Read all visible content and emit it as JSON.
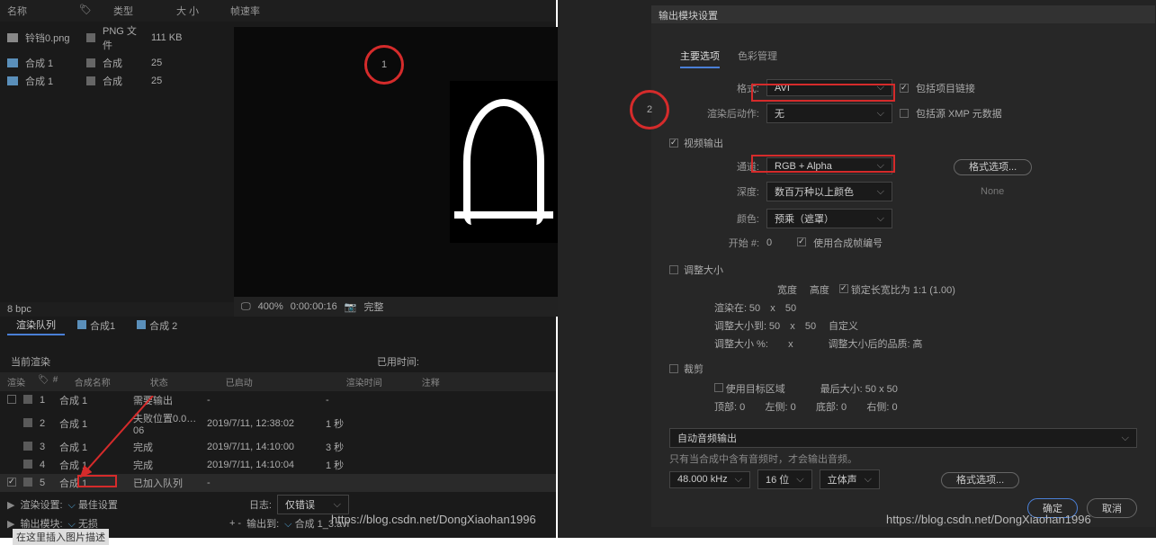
{
  "project": {
    "headers": {
      "name": "名称",
      "label": "类型",
      "size": "大 小",
      "fps": "帧速率"
    },
    "rows": [
      {
        "name": "铃铛0.png",
        "type": "PNG 文件",
        "size": "111 KB",
        "fps": ""
      },
      {
        "name": "合成 1",
        "type": "合成",
        "size": "25",
        "fps": ""
      },
      {
        "name": "合成 1",
        "type": "合成",
        "size": "25",
        "fps": ""
      }
    ]
  },
  "bpc": "8 bpc",
  "timeline": {
    "zoom": "400%",
    "time": "0:00:00:16",
    "status": "完整"
  },
  "tabs": {
    "t1": "渲染队列",
    "t2": "合成1",
    "t3": "合成 2"
  },
  "render": {
    "current": "当前渲染",
    "elapsed": "已用时间:",
    "cols": {
      "render": "渲染",
      "num": "#",
      "name": "合成名称",
      "status": "状态",
      "started": "已启动",
      "time": "渲染时间",
      "notes": "注释"
    },
    "items": [
      {
        "n": "1",
        "name": "合成 1",
        "status": "需要输出",
        "start": "-",
        "time": "-"
      },
      {
        "n": "2",
        "name": "合成 1",
        "status": "失败位置0.0…06",
        "start": "2019/7/11, 12:38:02",
        "time": "1 秒"
      },
      {
        "n": "3",
        "name": "合成 1",
        "status": "完成",
        "start": "2019/7/11, 14:10:00",
        "time": "3 秒"
      },
      {
        "n": "4",
        "name": "合成 1",
        "status": "完成",
        "start": "2019/7/11, 14:10:04",
        "time": "1 秒"
      },
      {
        "n": "5",
        "name": "合成 1",
        "status": "已加入队列",
        "start": "-",
        "time": ""
      }
    ],
    "settings": {
      "label": "渲染设置:",
      "value": "最佳设置",
      "log_label": "日志:",
      "log_value": "仅错误"
    },
    "output": {
      "label": "输出模块:",
      "value": "无损",
      "plus": "+ -",
      "to_label": "输出到:",
      "to_value": "合成 1_3.avi"
    }
  },
  "dialog": {
    "title": "输出模块设置",
    "tabs": {
      "main": "主要选项",
      "color": "色彩管理"
    },
    "format": {
      "label": "格式:",
      "value": "AVI",
      "include": "包括项目链接"
    },
    "postaction": {
      "label": "渲染后动作:",
      "value": "无",
      "xmp": "包括源 XMP 元数据"
    },
    "video": {
      "hdr": "视频输出",
      "channel_label": "通道:",
      "channel": "RGB + Alpha",
      "depth_label": "深度:",
      "depth": "数百万种以上颜色",
      "color_label": "颜色:",
      "color": "预乘（遮罩）",
      "start_label": "开始 #:",
      "start": "0",
      "use_comp": "使用合成帧编号",
      "fmt_opt": "格式选项...",
      "none": "None"
    },
    "resize": {
      "hdr": "调整大小",
      "w": "宽度",
      "h": "高度",
      "lock": "锁定长宽比为 1:1 (1.00)",
      "render_at": "渲染在:",
      "r50a": "50",
      "x": "x",
      "r50b": "50",
      "resize_to": "调整大小到:",
      "custom": "自定义",
      "pct": "调整大小 %:",
      "quality": "调整大小后的品质:",
      "high": "高"
    },
    "crop": {
      "hdr": "裁剪",
      "roi": "使用目标区域",
      "final": "最后大小: 50 x 50",
      "top": "顶部: 0",
      "left": "左侧: 0",
      "bottom": "底部: 0",
      "right": "右侧: 0"
    },
    "audio": {
      "mode": "自动音频输出",
      "note": "只有当合成中含有音频时，才会输出音频。",
      "khz": "48.000 kHz",
      "bit": "16 位",
      "stereo": "立体声",
      "fmt_opt": "格式选项..."
    },
    "ok": "确定",
    "cancel": "取消"
  },
  "markers": {
    "m1": "1",
    "m2": "2"
  },
  "watermark": "https://blog.csdn.net/DongXiaohan1996",
  "insert": "在这里插入图片描述"
}
